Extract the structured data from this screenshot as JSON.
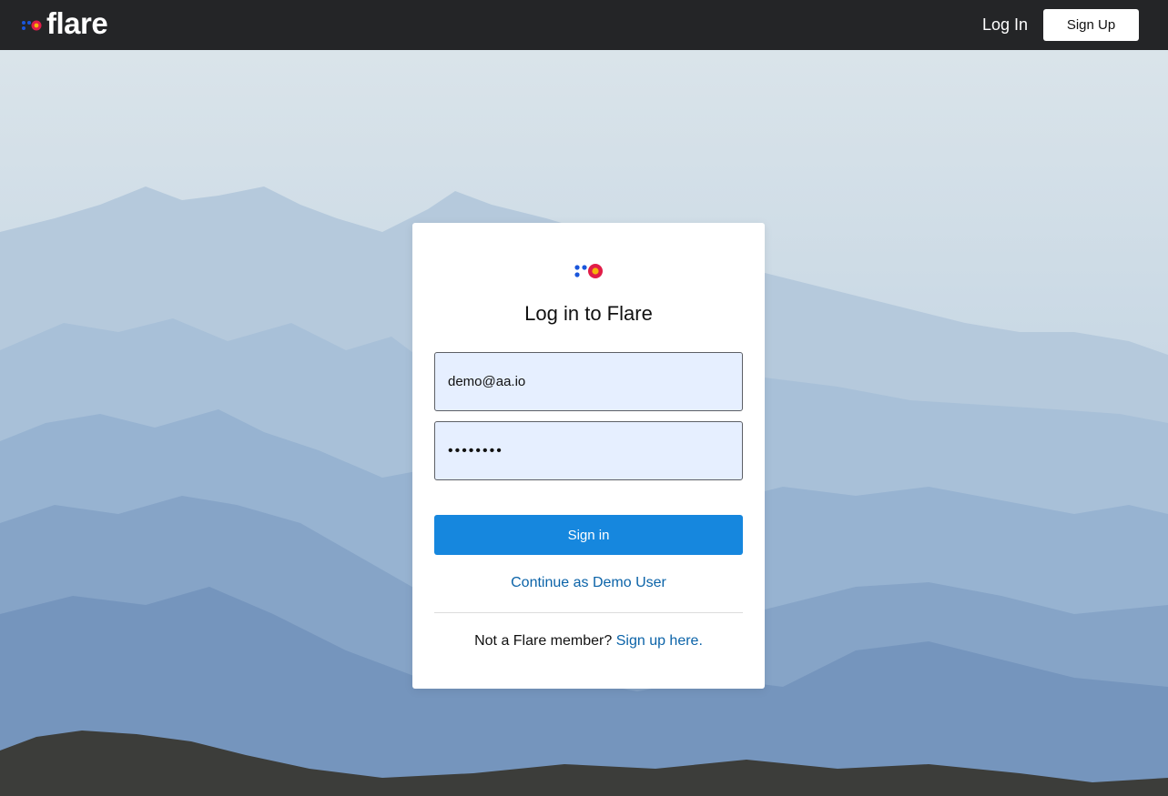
{
  "header": {
    "brand_name": "flare",
    "login_label": "Log In",
    "signup_label": "Sign Up"
  },
  "login_card": {
    "title": "Log in to Flare",
    "email_value": "demo@aa.io",
    "password_value": "••••••••",
    "signin_label": "Sign in",
    "demo_link": "Continue as Demo User",
    "member_prompt": "Not a Flare member?",
    "signup_link": "Sign up here."
  },
  "colors": {
    "topbar": "#242527",
    "primary_button": "#1687de",
    "link": "#0b63a8",
    "input_background": "#e6efff",
    "logo_blue": "#1a56db",
    "logo_red": "#e11d48",
    "logo_yellow": "#f5b50a"
  },
  "icons": {
    "brand_logo": "flare-logo-icon",
    "card_logo": "flare-logo-icon"
  }
}
